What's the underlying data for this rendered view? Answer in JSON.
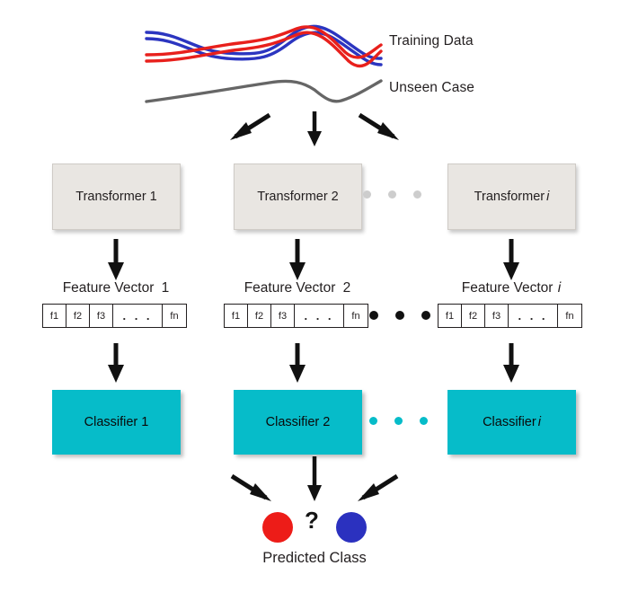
{
  "figure": {
    "title": "Ensemble transformer-classifier prediction pipeline",
    "background": "#ffffff"
  },
  "colors": {
    "training_blue": "#2b35c0",
    "training_red": "#e8201c",
    "unseen_gray": "#666666",
    "transformer_fill": "#e9e6e2",
    "transformer_border": "#cfcbc6",
    "classifier_fill": "#06bcc9",
    "arrow_black": "#111111",
    "dot_gray": "#cdcdcd",
    "predicted_red": "#ed1c18",
    "predicted_blue": "#2b31bf",
    "text": "#231f20"
  },
  "top": {
    "training_data_label": "Training Data",
    "unseen_case_label": "Unseen Case"
  },
  "columns": [
    {
      "transformer_label": "Transformer",
      "transformer_index": "1",
      "transformer_index_italic": false,
      "feature_vector_label": "Feature Vector",
      "feature_vector_index": "1",
      "feature_vector_index_italic": false,
      "cells": [
        "f1",
        "f2",
        "f3",
        ". . .",
        "fn"
      ],
      "classifier_label": "Classifier",
      "classifier_index": "1",
      "classifier_index_italic": false
    },
    {
      "transformer_label": "Transformer",
      "transformer_index": "2",
      "transformer_index_italic": false,
      "feature_vector_label": "Feature Vector",
      "feature_vector_index": "2",
      "feature_vector_index_italic": false,
      "cells": [
        "f1",
        "f2",
        "f3",
        ". . .",
        "fn"
      ],
      "classifier_label": "Classifier",
      "classifier_index": "2",
      "classifier_index_italic": false
    },
    {
      "transformer_label": "Transformer",
      "transformer_index": "i",
      "transformer_index_italic": true,
      "feature_vector_label": "Feature Vector",
      "feature_vector_index": "i",
      "feature_vector_index_italic": true,
      "cells": [
        "f1",
        "f2",
        "f3",
        ". . .",
        "fn"
      ],
      "classifier_label": "Classifier",
      "classifier_index": "i",
      "classifier_index_italic": true
    }
  ],
  "ellipsis": {
    "transformer_row_dots": 3,
    "feature_vector_row_dots": 3,
    "classifier_row_dots": 3
  },
  "prediction": {
    "question_mark": "?",
    "label": "Predicted Class",
    "class_a_color": "#ed1c18",
    "class_b_color": "#2b31bf"
  },
  "chart_data": {
    "type": "line",
    "title": "Training Data and Unseen Case curves",
    "xlabel": "",
    "ylabel": "",
    "series": [
      {
        "name": "Training Data (blue 1)",
        "color": "#2b35c0",
        "x": [
          0,
          0.18,
          0.38,
          0.55,
          0.72,
          0.88,
          1.0
        ],
        "y": [
          0.8,
          0.55,
          0.52,
          0.82,
          0.58,
          0.46,
          0.62
        ]
      },
      {
        "name": "Training Data (blue 2)",
        "color": "#2b35c0",
        "x": [
          0,
          0.18,
          0.38,
          0.55,
          0.72,
          0.88,
          1.0
        ],
        "y": [
          0.72,
          0.46,
          0.44,
          0.74,
          0.48,
          0.36,
          0.52
        ]
      },
      {
        "name": "Training Data (red 1)",
        "color": "#e8201c",
        "x": [
          0,
          0.18,
          0.38,
          0.55,
          0.72,
          0.88,
          1.0
        ],
        "y": [
          0.46,
          0.58,
          0.7,
          0.8,
          0.42,
          0.32,
          0.7
        ]
      },
      {
        "name": "Training Data (red 2)",
        "color": "#e8201c",
        "x": [
          0,
          0.18,
          0.38,
          0.55,
          0.72,
          0.88,
          1.0
        ],
        "y": [
          0.38,
          0.5,
          0.62,
          0.72,
          0.26,
          0.22,
          0.6
        ]
      },
      {
        "name": "Unseen Case",
        "color": "#666666",
        "x": [
          0,
          0.25,
          0.5,
          0.62,
          0.75,
          0.88,
          1.0
        ],
        "y": [
          0.18,
          0.36,
          0.54,
          0.5,
          0.1,
          0.18,
          0.44
        ]
      }
    ],
    "legend_position": "right",
    "grid": false
  }
}
